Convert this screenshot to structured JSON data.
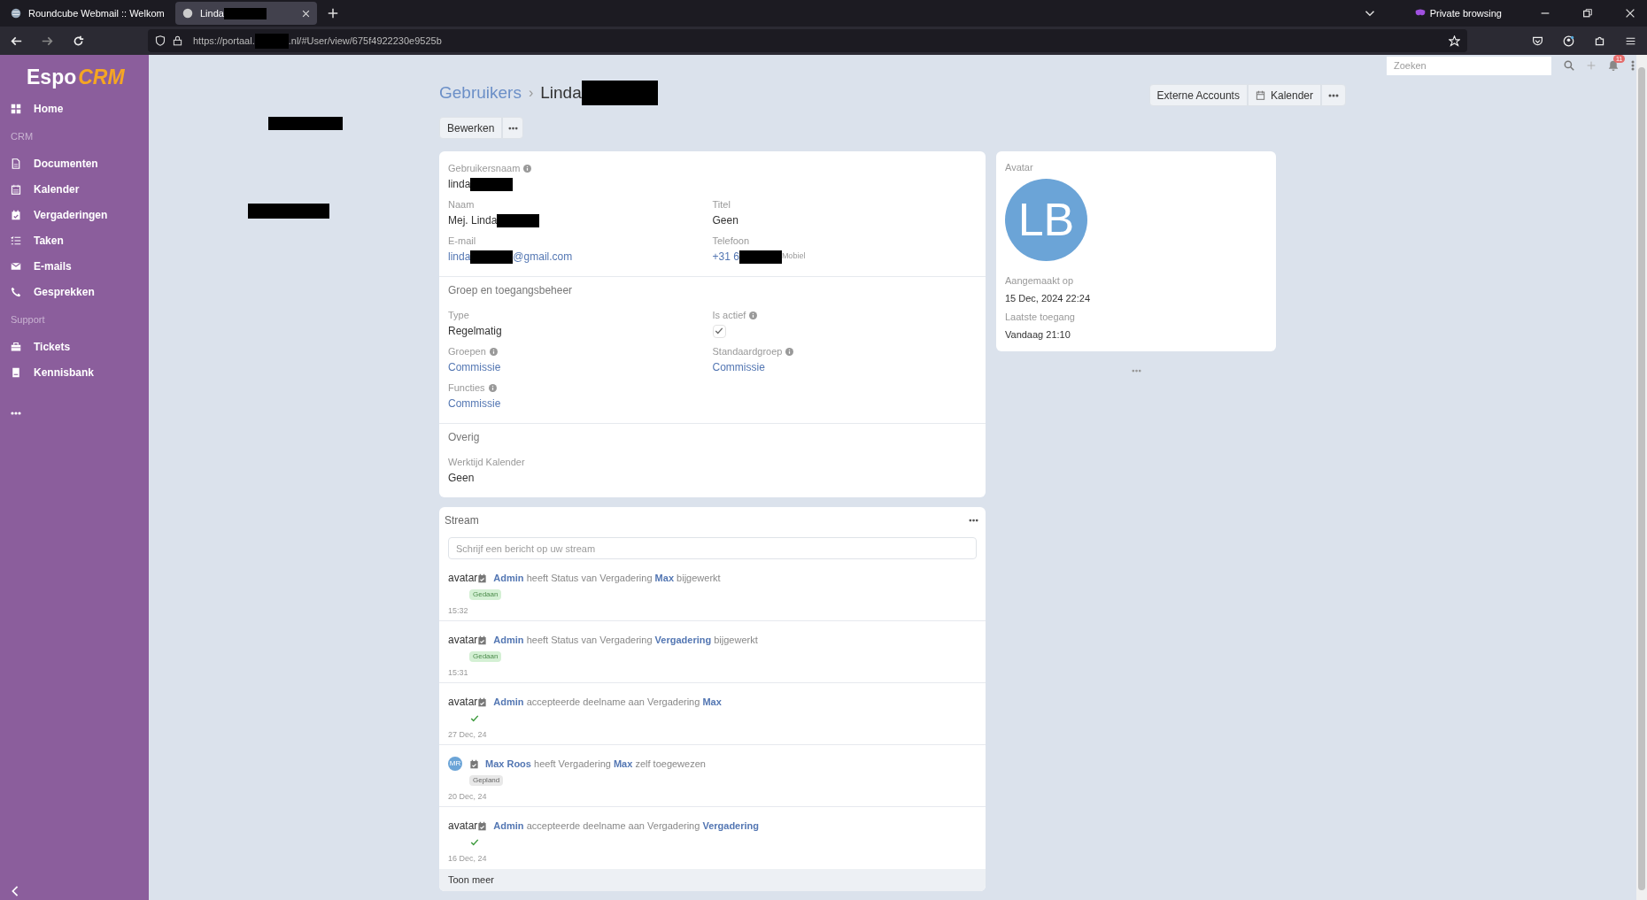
{
  "browser": {
    "tabs": [
      {
        "title": "Roundcube Webmail :: Welkom",
        "selected": false,
        "redacted": false
      },
      {
        "title": "Linda",
        "selected": true,
        "redacted": true
      }
    ],
    "address": {
      "start": "https://portaal.",
      "end": ".nl/#User/view/675f4922230e9525b"
    },
    "private_label": "Private browsing"
  },
  "sidebar": {
    "items": [
      {
        "kind": "link",
        "label": "Home"
      },
      {
        "kind": "header",
        "label": "CRM"
      },
      {
        "kind": "link",
        "label": "Documenten"
      },
      {
        "kind": "link",
        "label": "Kalender"
      },
      {
        "kind": "link",
        "label": "Vergaderingen"
      },
      {
        "kind": "link",
        "label": "Taken"
      },
      {
        "kind": "link",
        "label": "E-mails"
      },
      {
        "kind": "link",
        "label": "Gesprekken"
      },
      {
        "kind": "header",
        "label": "Support"
      },
      {
        "kind": "link",
        "label": "Tickets"
      },
      {
        "kind": "link",
        "label": "Kennisbank"
      }
    ]
  },
  "topbar": {
    "search": {
      "placeholder": "Zoeken"
    },
    "notification_count": "11"
  },
  "logo": {
    "start": "Espo",
    "end": "CRM"
  },
  "header": {
    "breadcrumb": "Gebruikers",
    "separator": "›",
    "title": "Linda",
    "title_redacted": true,
    "actions": [
      "Externe Accounts",
      "Kalender"
    ],
    "edit_button": "Bewerken"
  },
  "detail": {
    "sections": [
      {
        "rows": [
          [
            {
              "label": "Gebruikersnaam",
              "info": true,
              "kind": "text",
              "value": "linda",
              "redacted": true
            }
          ],
          [
            {
              "label": "Naam",
              "info": false,
              "kind": "text",
              "value": "Mej. Linda",
              "redacted": true
            },
            {
              "label": "Titel",
              "info": false,
              "kind": "text",
              "value": "Geen",
              "redacted": false
            }
          ],
          [
            {
              "label": "E-mail",
              "info": false,
              "kind": "link",
              "value": "linda",
              "redacted": true,
              "after": "@gmail.com"
            },
            {
              "label": "Telefoon",
              "info": false,
              "kind": "link",
              "value": "+31 6",
              "redacted": true,
              "note": "Mobiel"
            }
          ]
        ]
      },
      {
        "title": "Groep en toegangsbeheer",
        "rows": [
          [
            {
              "label": "Type",
              "info": false,
              "kind": "text",
              "value": "Regelmatig",
              "redacted": false
            },
            {
              "label": "Is actief",
              "info": true,
              "kind": "check",
              "checked": true
            }
          ],
          [
            {
              "label": "Groepen",
              "info": true,
              "kind": "link",
              "value": "Commissie",
              "redacted": false
            },
            {
              "label": "Standaardgroep",
              "info": true,
              "kind": "link",
              "value": "Commissie",
              "redacted": false
            }
          ],
          [
            {
              "label": "Functies",
              "info": true,
              "kind": "link",
              "value": "Commissie",
              "redacted": false
            }
          ]
        ]
      },
      {
        "title": "Overig",
        "rows": [
          [
            {
              "label": "Werktijd Kalender",
              "info": false,
              "kind": "text",
              "value": "Geen",
              "redacted": false
            }
          ]
        ]
      }
    ]
  },
  "side_panel": {
    "avatar_label": "Avatar",
    "initials": "LB",
    "fields": [
      {
        "label": "Aangemaakt op",
        "value": "15 Dec, 2024 22:24"
      },
      {
        "label": "Laatste toegang",
        "value": "Vandaag 21:10"
      }
    ]
  },
  "stream": {
    "title": "Stream",
    "placeholder": "Schrijf een bericht op uw stream",
    "show_more": "Toon meer",
    "items": [
      {
        "avatar": {
          "kind": "text",
          "text": "avatar"
        },
        "message": [
          {
            "kind": "link",
            "text": "Admin"
          },
          {
            "kind": "plain",
            "text": "heeft Status van Vergadering"
          },
          {
            "kind": "link",
            "text": "Max"
          },
          {
            "kind": "plain",
            "text": "bijgewerkt"
          }
        ],
        "detail": {
          "kind": "badge",
          "text": "Gedaan",
          "color": "#d4f0d4"
        },
        "time": "15:32"
      },
      {
        "avatar": {
          "kind": "text",
          "text": "avatar"
        },
        "message": [
          {
            "kind": "link",
            "text": "Admin"
          },
          {
            "kind": "plain",
            "text": "heeft Status van Vergadering"
          },
          {
            "kind": "link",
            "text": "Vergadering"
          },
          {
            "kind": "plain",
            "text": "bijgewerkt"
          }
        ],
        "detail": {
          "kind": "badge",
          "text": "Gedaan",
          "color": "#d4f0d4"
        },
        "time": "15:31"
      },
      {
        "avatar": {
          "kind": "text",
          "text": "avatar"
        },
        "message": [
          {
            "kind": "link",
            "text": "Admin"
          },
          {
            "kind": "plain",
            "text": "accepteerde deelname aan Vergadering"
          },
          {
            "kind": "link",
            "text": "Max"
          }
        ],
        "detail": {
          "kind": "check"
        },
        "time": "27 Dec, 24"
      },
      {
        "avatar": {
          "kind": "initials",
          "text": "MR"
        },
        "message": [
          {
            "kind": "link",
            "text": "Max Roos"
          },
          {
            "kind": "plain",
            "text": "heeft Vergadering"
          },
          {
            "kind": "link",
            "text": "Max"
          },
          {
            "kind": "plain",
            "text": "zelf toegewezen"
          }
        ],
        "detail": {
          "kind": "badge",
          "text": "Gepland",
          "color": "#e8e8e8"
        },
        "time": "20 Dec, 24"
      },
      {
        "avatar": {
          "kind": "text",
          "text": "avatar"
        },
        "message": [
          {
            "kind": "link",
            "text": "Admin"
          },
          {
            "kind": "plain",
            "text": "accepteerde deelname aan Vergadering"
          },
          {
            "kind": "link",
            "text": "Vergadering"
          }
        ],
        "detail": {
          "kind": "check"
        },
        "time": "16 Dec, 24"
      }
    ]
  }
}
